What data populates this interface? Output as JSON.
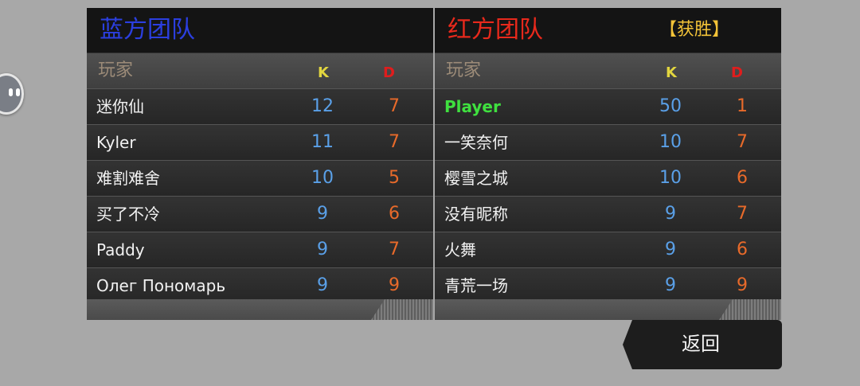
{
  "blue_team": {
    "name": "蓝方团队",
    "color": "#2b3fe0",
    "headers": {
      "player": "玩家",
      "k": "K",
      "d": "D"
    },
    "rows": [
      {
        "name": "迷你仙",
        "k": "12",
        "d": "7"
      },
      {
        "name": "Kyler",
        "k": "11",
        "d": "7"
      },
      {
        "name": "难割难舍",
        "k": "10",
        "d": "5"
      },
      {
        "name": "买了不冷",
        "k": "9",
        "d": "6"
      },
      {
        "name": "Paddy",
        "k": "9",
        "d": "7"
      },
      {
        "name": "Олег Пономарь",
        "k": "9",
        "d": "9"
      }
    ]
  },
  "red_team": {
    "name": "红方团队",
    "color": "#e8291c",
    "result": "【获胜】",
    "headers": {
      "player": "玩家",
      "k": "K",
      "d": "D"
    },
    "rows": [
      {
        "name": "Player",
        "k": "50",
        "d": "1"
      },
      {
        "name": "一笑奈何",
        "k": "10",
        "d": "7"
      },
      {
        "name": "樱雪之城",
        "k": "10",
        "d": "6"
      },
      {
        "name": "没有昵称",
        "k": "9",
        "d": "7"
      },
      {
        "name": "火舞",
        "k": "9",
        "d": "6"
      },
      {
        "name": "青荒一场",
        "k": "9",
        "d": "9"
      }
    ]
  },
  "back_button": {
    "label": "返回"
  },
  "side_button": {
    "icon": "chat-face-icon"
  }
}
